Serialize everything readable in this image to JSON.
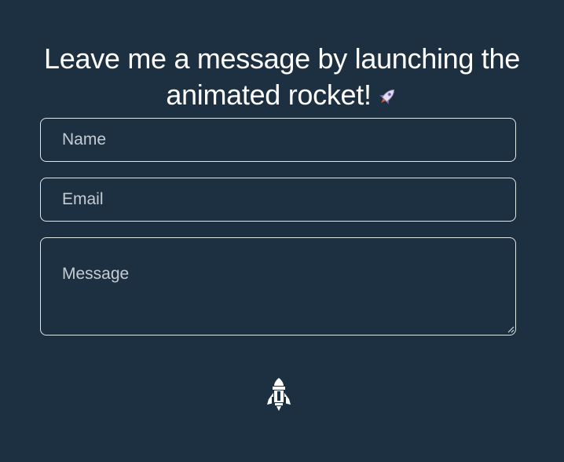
{
  "heading": {
    "line1": "Leave me a message by launching the",
    "line2": "animated rocket!"
  },
  "form": {
    "name_placeholder": "Name",
    "email_placeholder": "Email",
    "message_placeholder": "Message"
  },
  "icons": {
    "heading_emoji": "rocket-emoji-icon",
    "submit": "rocket-icon"
  },
  "colors": {
    "background": "#1d3041",
    "text": "#ffffff",
    "border": "#dfe6ea",
    "placeholder": "#c4ccd2"
  }
}
